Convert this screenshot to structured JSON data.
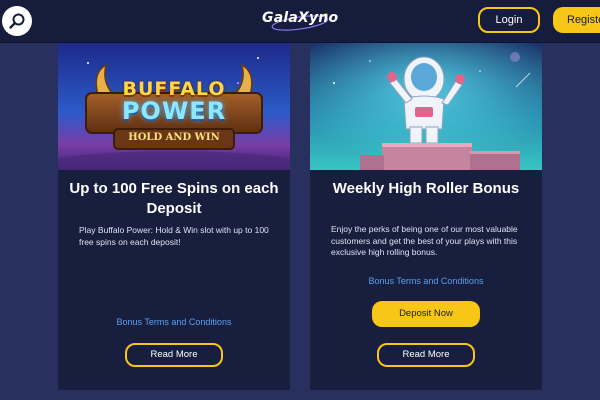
{
  "header": {
    "logo_text": "GalaXyno",
    "login_label": "Login",
    "register_label": "Register"
  },
  "cards": [
    {
      "image_title_line1": "BUFFALO",
      "image_title_line2": "POWER",
      "image_subtitle": "HOLD AND WIN",
      "title": "Up to 100 Free Spins on each Deposit",
      "description": "Play Buffalo Power: Hold & Win slot with up to 100 free spins on each deposit!",
      "terms_label": "Bonus Terms and Conditions",
      "read_more_label": "Read More"
    },
    {
      "title": "Weekly High Roller Bonus",
      "description": "Enjoy the perks of being one of our most valuable customers and get the best of your plays with this exclusive high rolling bonus.",
      "terms_label": "Bonus Terms and Conditions",
      "deposit_label": "Deposit Now",
      "read_more_label": "Read More"
    }
  ],
  "colors": {
    "accent": "#f7c617",
    "link": "#5aa0f0",
    "page_bg": "#27305f",
    "card_bg": "#171e3e",
    "header_bg": "#161d3c"
  },
  "icons": {
    "search": "search-icon"
  }
}
